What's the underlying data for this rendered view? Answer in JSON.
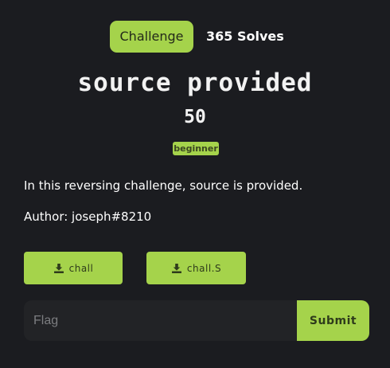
{
  "header": {
    "tab_challenge": "Challenge",
    "tab_solves": "365 Solves"
  },
  "challenge": {
    "name": "source provided",
    "points": "50",
    "category_badge": "beginner",
    "description": "In this reversing challenge, source is provided.",
    "author": "Author: joseph#8210"
  },
  "files": [
    {
      "label": "chall",
      "icon": "download-icon"
    },
    {
      "label": "chall.S",
      "icon": "download-icon"
    }
  ],
  "flag_form": {
    "placeholder": "Flag",
    "value": "",
    "submit_label": "Submit"
  },
  "colors": {
    "background": "#1b1c20",
    "accent": "#a5d34b",
    "input_bg": "#222326"
  }
}
